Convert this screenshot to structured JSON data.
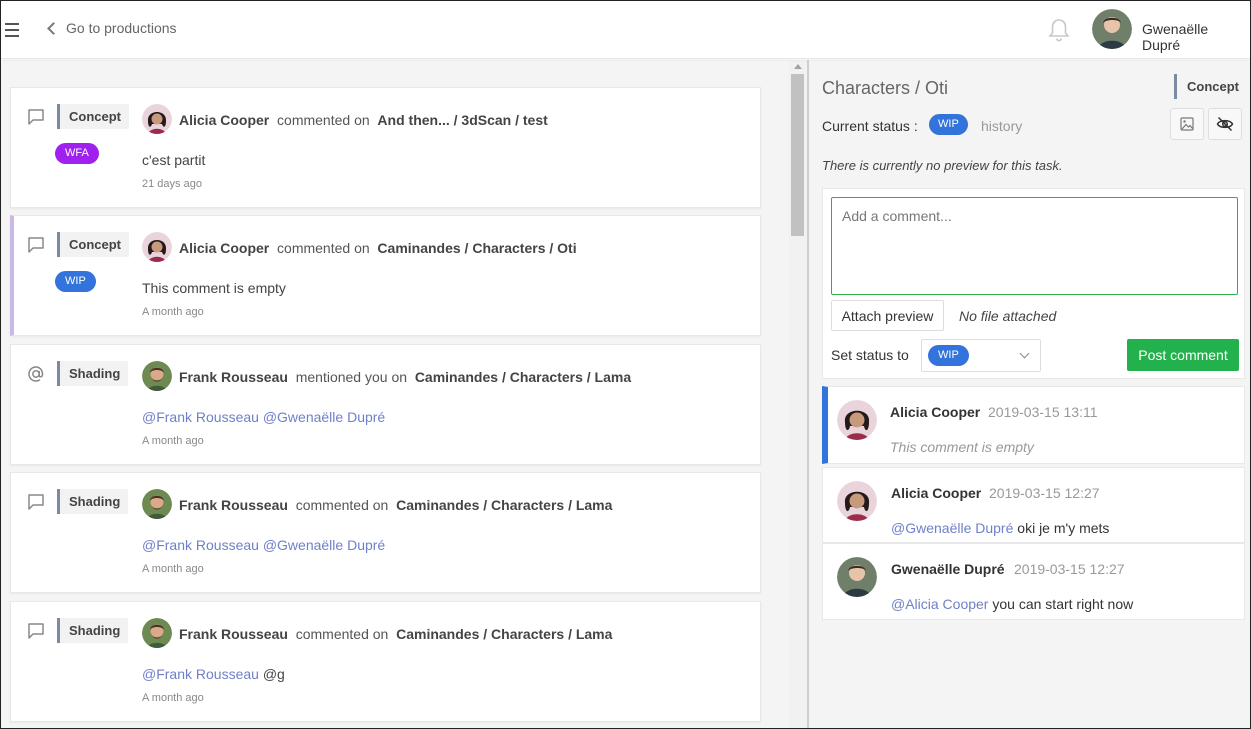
{
  "topbar": {
    "back_label": "Go to productions",
    "user_name": "Gwenaëlle Dupré"
  },
  "feed": {
    "items": [
      {
        "kind": "comment",
        "task_type": "Concept",
        "status": "WFA",
        "status_color": "#a020f0",
        "author": "Alicia Cooper",
        "action": "commented on",
        "target": "And then... / 3dScan / test",
        "body": "c'est partit",
        "time": "21 days ago"
      },
      {
        "kind": "comment",
        "task_type": "Concept",
        "status": "WIP",
        "status_color": "#3273dc",
        "author": "Alicia Cooper",
        "action": "commented on",
        "target": "Caminandes / Characters / Oti",
        "body": "This comment is empty",
        "time": "A month ago"
      },
      {
        "kind": "mention",
        "task_type": "Shading",
        "author": "Frank Rousseau",
        "action": "mentioned you on",
        "target": "Caminandes / Characters / Lama",
        "mention_1": "@Frank Rousseau",
        "mention_2": "@Gwenaëlle Dupré",
        "time": "A month ago"
      },
      {
        "kind": "comment",
        "task_type": "Shading",
        "author": "Frank Rousseau",
        "action": "commented on",
        "target": "Caminandes / Characters / Lama",
        "mention_1": "@Frank Rousseau",
        "mention_2": "@Gwenaëlle Dupré",
        "time": "A month ago"
      },
      {
        "kind": "comment",
        "task_type": "Shading",
        "author": "Frank Rousseau",
        "action": "commented on",
        "target": "Caminandes / Characters / Lama",
        "mention_1": "@Frank Rousseau",
        "plain": "@g",
        "time": "A month ago"
      }
    ]
  },
  "panel": {
    "title": "Characters / Oti",
    "task_type": "Concept",
    "current_status_label": "Current status :",
    "current_status": "WIP",
    "history_label": "history",
    "no_preview": "There is currently no preview for this task.",
    "comment_placeholder": "Add a comment...",
    "attach_label": "Attach preview",
    "no_file": "No file attached",
    "set_status_label": "Set status to",
    "set_status_value": "WIP",
    "post_label": "Post comment",
    "comments": [
      {
        "author": "Alicia Cooper",
        "date": "2019-03-15 13:11",
        "text": "This comment is empty"
      },
      {
        "author": "Alicia Cooper",
        "date": "2019-03-15 12:27",
        "mention": "@Gwenaëlle Dupré",
        "text": "oki je m'y mets"
      },
      {
        "author": "Gwenaëlle Dupré",
        "date": "2019-03-15 12:27",
        "mention": "@Alicia Cooper",
        "text": "you can start right now"
      }
    ]
  },
  "colors": {
    "wip": "#3273dc",
    "wfa": "#a020f0",
    "post_button": "#22b14c",
    "mention": "#6f80c9",
    "selected_bar": "#c9b8e8"
  },
  "icons": {
    "menu": "hamburger-icon",
    "back": "chevron-left-icon",
    "bell": "bell-icon",
    "comment": "comment-icon",
    "mention": "at-icon",
    "image": "image-icon",
    "hide": "eye-slash-icon"
  }
}
